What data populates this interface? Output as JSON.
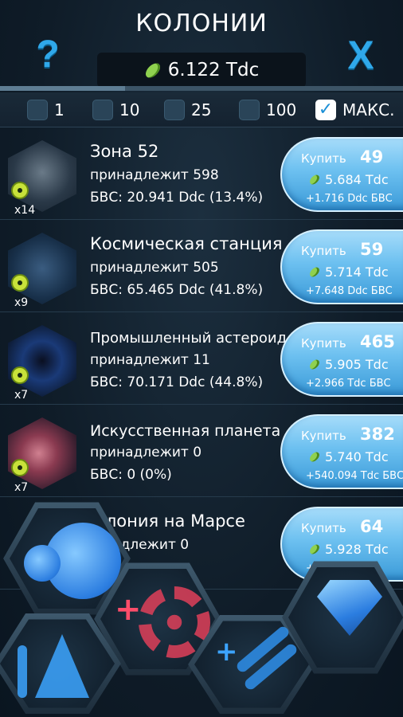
{
  "header": {
    "title": "КОЛОНИИ",
    "help_icon": "?",
    "close_icon": "X",
    "currency_value": "6.122 Tdc",
    "currency_icon": "bean-icon"
  },
  "progress": {
    "fraction": 0.31
  },
  "quantities": [
    {
      "label": "1",
      "checked": false
    },
    {
      "label": "10",
      "checked": false
    },
    {
      "label": "25",
      "checked": false
    },
    {
      "label": "100",
      "checked": false
    },
    {
      "label": "МАКС.",
      "checked": true
    }
  ],
  "check_mark": "✓",
  "colonies": [
    {
      "name": "Зона 52",
      "owned": "принадлежит 598",
      "bvs": "БВС: 20.941 Ddc (13.4%)",
      "mult": "x14",
      "buy_label": "Купить",
      "buy_qty": "49",
      "cost": "5.684 Tdc",
      "gain": "+1.716 Ddc БВС"
    },
    {
      "name": "Космическая станция",
      "owned": "принадлежит 505",
      "bvs": "БВС: 65.465 Ddc (41.8%)",
      "mult": "x9",
      "buy_label": "Купить",
      "buy_qty": "59",
      "cost": "5.714 Tdc",
      "gain": "+7.648 Ddc БВС"
    },
    {
      "name": "Промышленный астероид",
      "owned": "принадлежит 11",
      "bvs": "БВС: 70.171 Ddc (44.8%)",
      "mult": "x7",
      "buy_label": "Купить",
      "buy_qty": "465",
      "cost": "5.905 Tdc",
      "gain": "+2.966 Tdc БВС"
    },
    {
      "name": "Искусственная планета",
      "owned": "принадлежит 0",
      "bvs": "БВС: 0 (0%)",
      "mult": "x7",
      "buy_label": "Купить",
      "buy_qty": "382",
      "cost": "5.740 Tdc",
      "gain": "+540.094 Tdc БВС"
    },
    {
      "name": "олония на Марсе",
      "owned": "надлежит 0",
      "bvs": "",
      "mult": "",
      "buy_label": "Купить",
      "buy_qty": "64",
      "cost": "5.928 Tdc",
      "gain": "+5"
    }
  ],
  "nav": [
    {
      "name": "nav-colonies",
      "icon": "bubbles-icon"
    },
    {
      "name": "nav-upgrades",
      "icon": "gear-icon"
    },
    {
      "name": "nav-research",
      "icon": "flask-icon"
    },
    {
      "name": "nav-dna",
      "icon": "dna-icon"
    },
    {
      "name": "nav-gems",
      "icon": "gem-icon"
    }
  ]
}
